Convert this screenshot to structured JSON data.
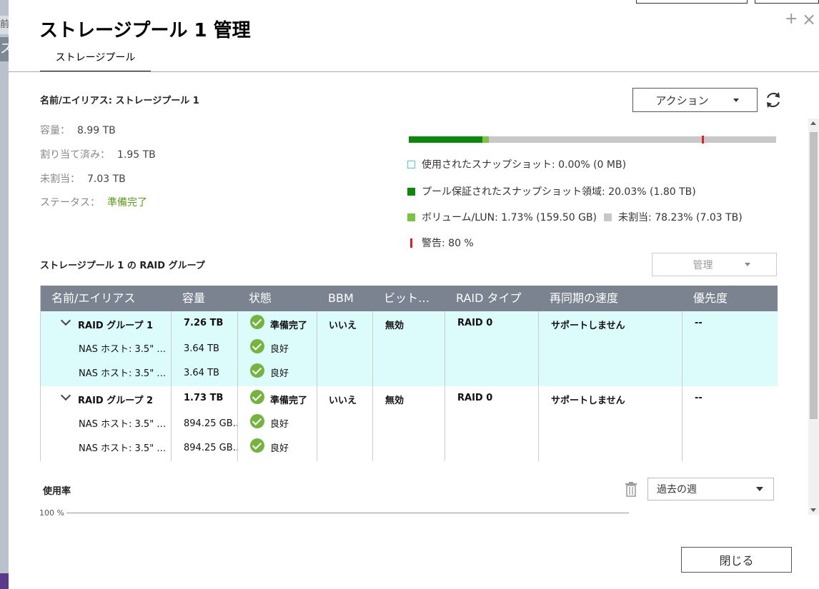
{
  "background": {
    "left_tab_1": "前",
    "left_tab_2": "ス"
  },
  "dialog": {
    "title": "ストレージプール 1 管理",
    "close_icon": "×",
    "add_icon": "+",
    "tab_label": "ストレージプール"
  },
  "pool": {
    "name_label": "名前/エイリアス: ストレージプール 1",
    "capacity_label": "容量：",
    "capacity_value": "8.99 TB",
    "allocated_label": "割り当て済み：",
    "allocated_value": "1.95 TB",
    "unallocated_label": "未割当：",
    "unallocated_value": "7.03 TB",
    "status_label": "ステータス：",
    "status_value": "準備完了"
  },
  "actions": {
    "action_label": "アクション",
    "refresh_icon": "refresh-icon"
  },
  "usage_bar": {
    "segments": [
      {
        "name": "snapshot-reserved",
        "percent": 20.03,
        "color": "#0a8a0a"
      },
      {
        "name": "volume",
        "percent": 1.73,
        "color": "#7dc242"
      },
      {
        "name": "unallocated",
        "percent": 78.23,
        "color": "#c8c8c8"
      }
    ],
    "warning_percent": 80,
    "warning_color": "#e02020"
  },
  "legend": {
    "used_snapshot": "使用されたスナップショット: 0.00% (0 MB)",
    "snapshot_reserved": "プール保証されたスナップショット領域: 20.03% (1.80 TB)",
    "volume": "ボリューム/LUN: 1.73% (159.50 GB)",
    "unallocated": "未割当: 78.23% (7.03 TB)",
    "warning": "警告: 80 %"
  },
  "raid_section": {
    "title": "ストレージプール 1 の RAID グループ",
    "manage_label": "管理"
  },
  "table": {
    "headers": [
      "名前/エイリアス",
      "容量",
      "状態",
      "BBM",
      "ビット…",
      "RAID タイプ",
      "再同期の速度",
      "優先度"
    ],
    "groups": [
      {
        "name": "RAID グループ 1",
        "capacity": "7.26 TB",
        "status": "準備完了",
        "bbm": "いいえ",
        "bitmap": "無効",
        "raid_type": "RAID 0",
        "resync": "サポートしません",
        "priority": "--",
        "disks": [
          {
            "name": "NAS ホスト: 3.5\" …",
            "capacity": "3.64 TB",
            "status": "良好"
          },
          {
            "name": "NAS ホスト: 3.5\" …",
            "capacity": "3.64 TB",
            "status": "良好"
          }
        ]
      },
      {
        "name": "RAID グループ 2",
        "capacity": "1.73 TB",
        "status": "準備完了",
        "bbm": "いいえ",
        "bitmap": "無効",
        "raid_type": "RAID 0",
        "resync": "サポートしません",
        "priority": "--",
        "disks": [
          {
            "name": "NAS ホスト: 3.5\" …",
            "capacity": "894.25 GB…",
            "status": "良好"
          },
          {
            "name": "NAS ホスト: 3.5\" …",
            "capacity": "894.25 GB…",
            "status": "良好"
          }
        ]
      }
    ],
    "selected_row_color": "#dcfbfb"
  },
  "usage_rate": {
    "title": "使用率",
    "range": "過去の週",
    "axis_label": "100 %"
  },
  "footer": {
    "close_label": "閉じる"
  }
}
